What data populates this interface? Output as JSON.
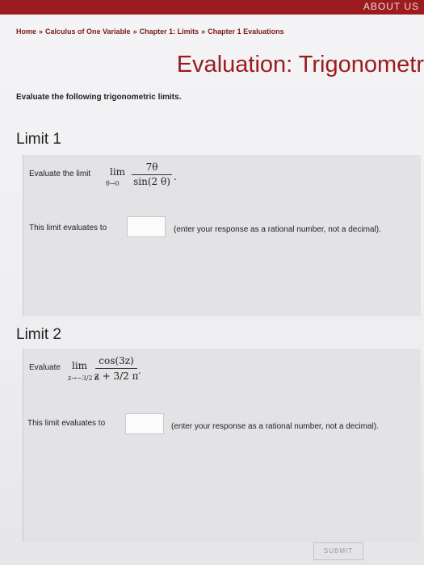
{
  "header": {
    "top_text": "ABOUT US"
  },
  "breadcrumb": {
    "items": [
      "Home",
      "Calculus of One Variable",
      "Chapter 1: Limits",
      "Chapter 1 Evaluations"
    ],
    "separator": "»"
  },
  "page": {
    "title": "Evaluation: Trigonometr",
    "intro": "Evaluate the following trigonometric limits."
  },
  "limit1": {
    "header": "Limit 1",
    "prompt": "Evaluate the limit",
    "lim": "lim",
    "sub": "θ→0",
    "numerator": "7θ",
    "denominator": "sin(2 θ)",
    "period": ".",
    "result_label": "This limit evaluates to",
    "answer_value": "",
    "note": "(enter your response as a rational number, not a decimal)."
  },
  "limit2": {
    "header": "Limit 2",
    "prompt": "Evaluate",
    "lim": "lim",
    "sub": "z→−3/2 π",
    "numerator": "cos(3z)",
    "denominator": "z + 3/2 π",
    "period": ".",
    "result_label": "This limit evaluates to",
    "answer_value": "",
    "note": "(enter your response as a rational number, not a decimal)."
  },
  "actions": {
    "submit_label": "SUBMIT"
  }
}
